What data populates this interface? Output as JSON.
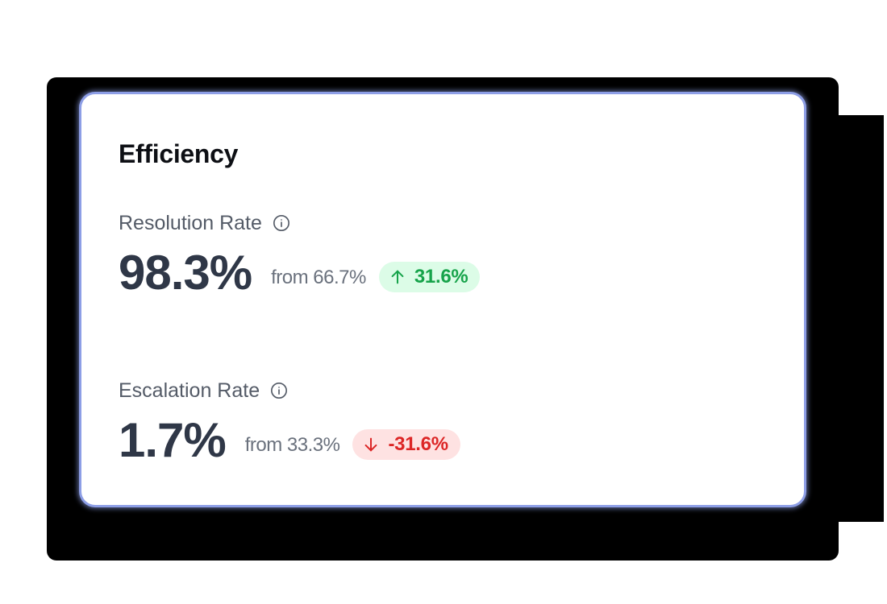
{
  "card": {
    "title": "Efficiency"
  },
  "metrics": [
    {
      "label": "Resolution Rate",
      "value": "98.3%",
      "from_text": "from 66.7%",
      "change": "31.6%",
      "direction": "up",
      "info_icon": "info-icon"
    },
    {
      "label": "Escalation Rate",
      "value": "1.7%",
      "from_text": "from 33.3%",
      "change": "-31.6%",
      "direction": "down",
      "info_icon": "info-icon"
    }
  ],
  "colors": {
    "card_border": "#8d9ee6",
    "value_text": "#2f3747",
    "positive_text": "#16a34a",
    "positive_bg": "#dcfce7",
    "negative_text": "#dc2626",
    "negative_bg": "#fee2e2"
  }
}
